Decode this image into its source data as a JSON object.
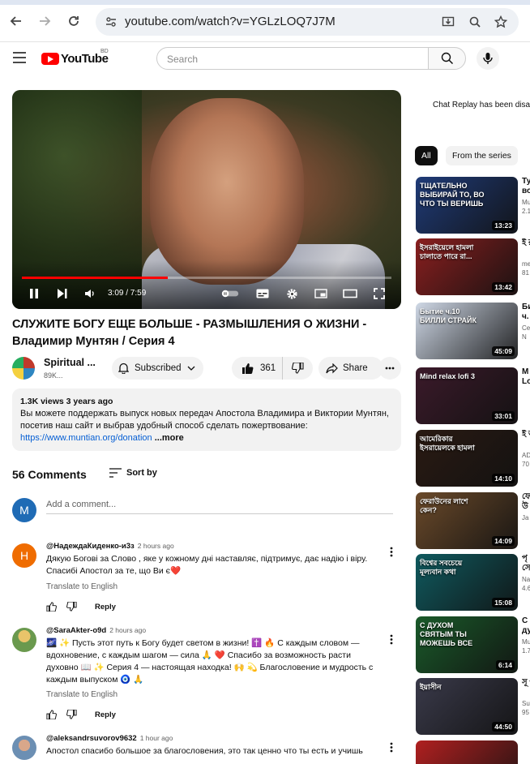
{
  "browser": {
    "url": "youtube.com/watch?v=YGLzLOQ7J7M"
  },
  "header": {
    "logo_text": "YouTube",
    "country_code": "BD",
    "search_placeholder": "Search"
  },
  "player": {
    "current_time": "3:09",
    "duration": "7:59",
    "time_display": "3:09 / 7:59",
    "progress_fraction": 0.395
  },
  "video": {
    "title": "СЛУЖИТЕ БОГУ ЕЩЕ БОЛЬШЕ - РАЗМЫШЛЕНИЯ О ЖИЗНИ - Владимир Мунтян / Серия 4",
    "channel_name": "Spiritual ...",
    "channel_subs": "89K...",
    "subscribed_label": "Subscribed",
    "likes": "361",
    "share_label": "Share"
  },
  "description": {
    "meta": "1.3K views  3 years ago",
    "text": "Вы можете поддержать выпуск новых передач Апостола Владимира и Виктории Мунтян, посетив наш сайт и выбрав удобный способ сделать пожертвование:",
    "link": "https://www.muntian.org/donation",
    "more_label": "...more"
  },
  "comments": {
    "count_label": "56 Comments",
    "sort_label": "Sort by",
    "add_placeholder": "Add a comment...",
    "my_avatar_letter": "M",
    "items": [
      {
        "avatar_letter": "Н",
        "handle": "@НадеждаКиденко-и3з",
        "time": "2 hours ago",
        "text": "Дякую Богові за Слово , яке у кожному дні наставляє, підтримує, дає надію і віру. Спасибі Апостол за те, що Ви є❤️",
        "translate": "Translate to English",
        "reply": "Reply"
      },
      {
        "avatar_letter": "",
        "handle": "@SaraAkter-o9d",
        "time": "2 hours ago",
        "text": "🌌 ✨ Пусть этот путь к Богу будет светом в жизни! ✝️ 🔥 С каждым словом — вдохновение, с каждым шагом — сила 🙏 ❤️ Спасибо за возможность расти духовно 📖 ✨ Серия 4 — настоящая находка! 🙌 💫 Благословение и мудрость с каждым выпуском 🧿 🙏",
        "translate": "Translate to English",
        "reply": "Reply"
      },
      {
        "avatar_letter": "",
        "handle": "@aleksandrsuvorov9632",
        "time": "1 hour ago",
        "text": "Апостол спасибо большое за благословения, это так ценно что ты есть и учишь",
        "translate": "",
        "reply": ""
      }
    ]
  },
  "sidebar": {
    "chat_replay": "Chat Replay has been disa",
    "chips": [
      "All",
      "From the series"
    ],
    "recommendations": [
      {
        "duration": "13:23",
        "overlay": "ТЩАТЕЛЬНО ВЫБИРАЙ ТО, ВО ЧТО ТЫ ВЕРИШЬ",
        "side_title": "Ту во",
        "side_meta": "Mu 2.1",
        "bg": "#1f3b78"
      },
      {
        "duration": "13:42",
        "overlay": "ইসরাইয়েলে হামলা চালাতে পারে রা...",
        "side_title": "ই রা",
        "side_meta": "me 81 N",
        "bg": "#8a1f1f"
      },
      {
        "duration": "45:09",
        "overlay": "Бытие ч.10 БИЛЛИ СТРАЙК",
        "side_title": "Би ч.",
        "side_meta": "Ce 6 N",
        "bg": "#cfd8e6"
      },
      {
        "duration": "33:01",
        "overlay": "Mind relax lofi 3",
        "side_title": "M Lo",
        "side_meta": "",
        "bg": "#3b1a2a"
      },
      {
        "duration": "14:10",
        "overlay": "আমেরিকার ইসরায়েলকে হামলা",
        "side_title": "ই আ",
        "side_meta": "AD 70",
        "bg": "#2a1a12"
      },
      {
        "duration": "14:09",
        "overlay": "ফেরাউনের লাশে কেন?",
        "side_title": "ফে উ",
        "side_meta": "Ja 52",
        "bg": "#6b4a2a"
      },
      {
        "duration": "15:08",
        "overlay": "বিশ্বের সবচেয়ে মূল্যবান কথা",
        "side_title": "পৃ সে",
        "side_meta": "Na 4.6",
        "bg": "#0f5a5f"
      },
      {
        "duration": "6:14",
        "overlay": "С ДУХОМ СВЯТЫМ ТЫ МОЖЕШЬ ВСЕ",
        "side_title": "С ду",
        "side_meta": "Mu 1.7",
        "bg": "#1a5a2a"
      },
      {
        "duration": "44:50",
        "overlay": "ইয়াসীন",
        "side_title": "সূ প",
        "side_meta": "Su 95",
        "bg": "#3a3a4a"
      },
      {
        "duration": "",
        "overlay": "",
        "side_title": "",
        "side_meta": "",
        "bg": "#b02020"
      }
    ]
  },
  "colors": {
    "accent_red": "#ff0000",
    "link_blue": "#065fd4",
    "muted_text": "#606060"
  }
}
